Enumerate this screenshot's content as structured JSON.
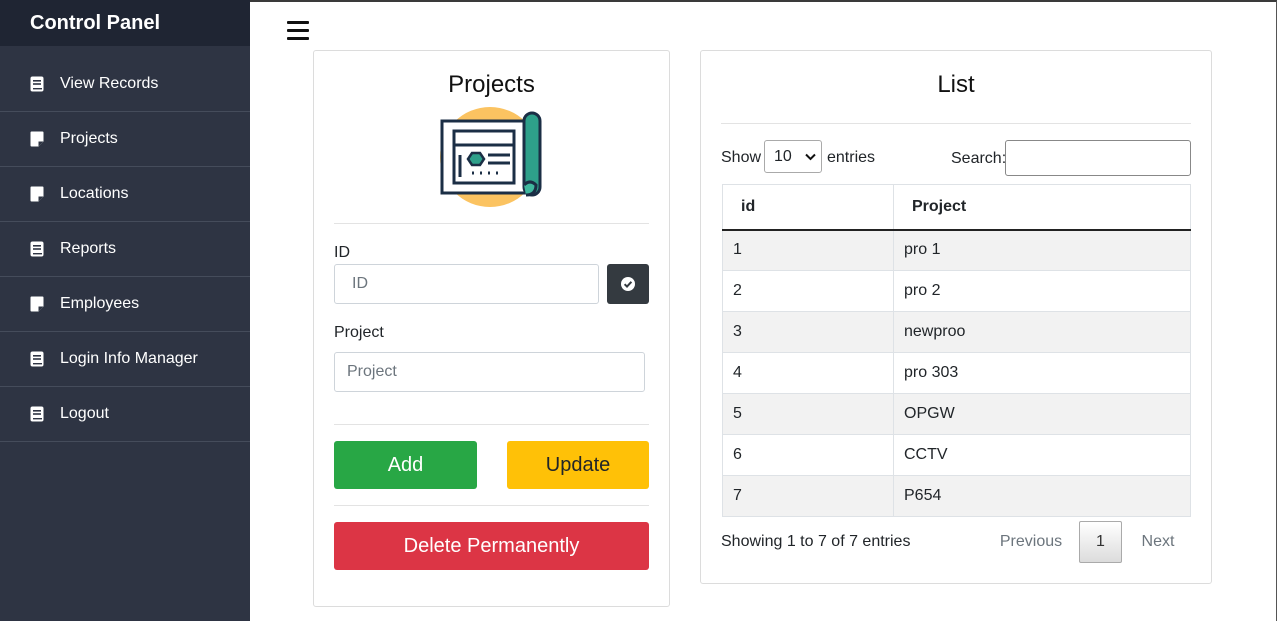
{
  "sidebar": {
    "title": "Control Panel",
    "items": [
      {
        "label": "View Records",
        "icon": "book-icon"
      },
      {
        "label": "Projects",
        "icon": "note-icon"
      },
      {
        "label": "Locations",
        "icon": "note-icon"
      },
      {
        "label": "Reports",
        "icon": "book-icon"
      },
      {
        "label": "Employees",
        "icon": "note-icon"
      },
      {
        "label": "Login Info Manager",
        "icon": "book-icon"
      },
      {
        "label": "Logout",
        "icon": "book-icon"
      }
    ]
  },
  "form": {
    "title": "Projects",
    "id_label": "ID",
    "id_placeholder": "ID",
    "project_label": "Project",
    "project_placeholder": "Project",
    "add_label": "Add",
    "update_label": "Update",
    "delete_label": "Delete Permanently"
  },
  "list": {
    "title": "List",
    "show_label": "Show",
    "entries_label": "entries",
    "page_size": "10",
    "search_label": "Search:",
    "search_value": "",
    "columns": [
      "id",
      "Project"
    ],
    "rows": [
      [
        "1",
        "pro 1"
      ],
      [
        "2",
        "pro 2"
      ],
      [
        "3",
        "newproo"
      ],
      [
        "4",
        "pro 303"
      ],
      [
        "5",
        "OPGW"
      ],
      [
        "6",
        "CCTV"
      ],
      [
        "7",
        "P654"
      ]
    ],
    "info": "Showing 1 to 7 of 7 entries",
    "previous_label": "Previous",
    "current_page": "1",
    "next_label": "Next"
  },
  "colors": {
    "sidebar_bg": "#2e3443",
    "sidebar_header_bg": "#1f2533",
    "add": "#28a745",
    "update": "#ffc107",
    "delete": "#dc3545",
    "check_button": "#343a40"
  }
}
